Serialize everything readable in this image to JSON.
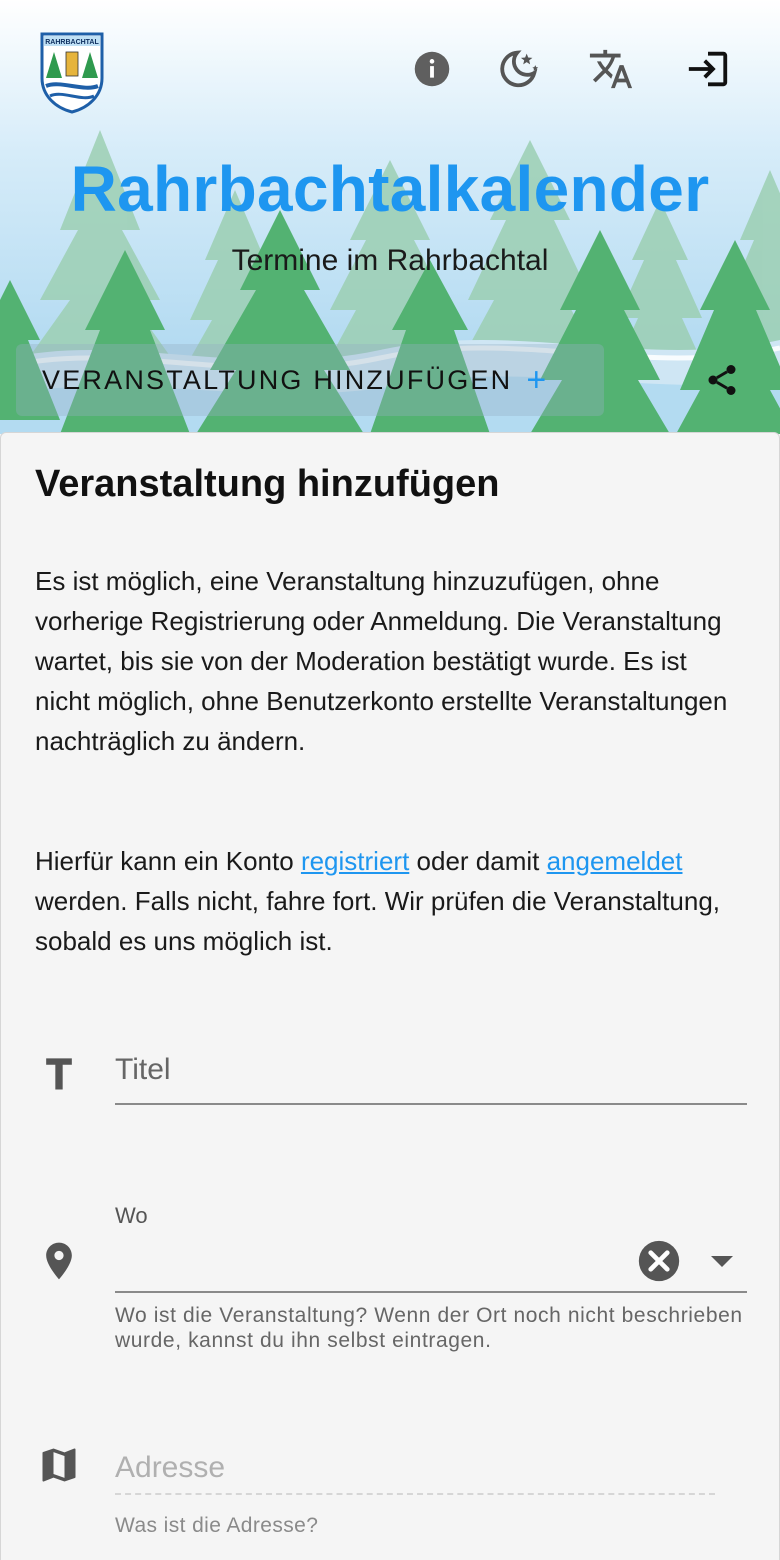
{
  "header": {
    "logo_text": "RAHRBACHTAL",
    "title": "Rahrbachtalkalender",
    "subtitle": "Termine im Rahrbachtal",
    "add_event_label": "VERANSTALTUNG HINZUFÜGEN",
    "add_event_plus": "+",
    "icons": [
      "info-icon",
      "dark-mode-moon-stars-icon",
      "translate-icon",
      "login-icon",
      "share-icon"
    ]
  },
  "card": {
    "title": "Veranstaltung hinzufügen",
    "paragraph1": "Es ist möglich, eine Veranstaltung hinzuzufügen, ohne vorherige Registrierung oder Anmeldung. Die Veranstaltung wartet, bis sie von der Moderation bestätigt wurde. Es ist nicht möglich, ohne Benutzerkonto erstellte Veranstaltungen nachträglich zu ändern.",
    "paragraph2_a": "Hierfür kann ein Konto ",
    "link_register": "registriert",
    "paragraph2_b": " oder damit ",
    "link_login": "angemeldet",
    "paragraph2_c": " werden. Falls nicht, fahre fort. Wir prüfen die Veranstaltung, sobald es uns möglich ist."
  },
  "form": {
    "title_placeholder": "Titel",
    "title_value": "",
    "where_label": "Wo",
    "where_value": "",
    "where_hint": "Wo ist die Veranstaltung? Wenn der Ort noch nicht beschrieben wurde, kannst du ihn selbst eintragen.",
    "address_placeholder": "Adresse",
    "address_value": "",
    "address_hint": "Was ist die Adresse?"
  },
  "colors": {
    "accent": "#1e96f0",
    "tree_dark": "#4caf6a",
    "tree_light": "#8dc8a6",
    "sky": "#cfe8f7"
  }
}
